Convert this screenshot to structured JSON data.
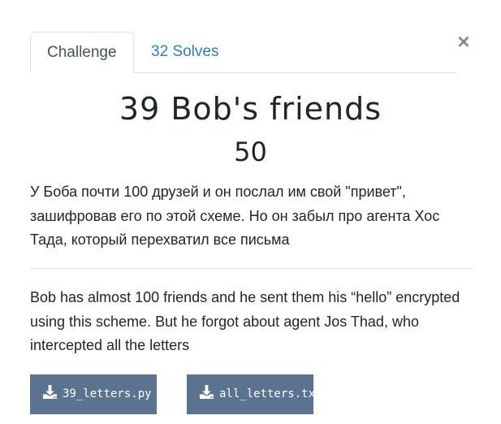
{
  "modal": {
    "close_symbol": "×",
    "tabs": [
      {
        "label": "Challenge",
        "active": true
      },
      {
        "label": "32 Solves",
        "active": false
      }
    ]
  },
  "challenge": {
    "title": "39 Bob's friends",
    "points": "50",
    "description_ru": "У Боба почти 100 друзей и он послал им свой \"привет\", зашифровав его по этой схеме. Но он забыл про агента Хос Тада, который перехватил все письма",
    "description_en": "Bob has almost 100 friends and he sent them his “hello” encrypted using this scheme. But he forgot about agent Jos Thad, who intercepted all the letters"
  },
  "files": [
    {
      "name": "39_letters.py",
      "icon": "download-icon"
    },
    {
      "name": "all_letters.txt",
      "icon": "download-icon"
    }
  ],
  "colors": {
    "accent_link": "#337ab7",
    "file_button_bg": "#5b7290",
    "text": "#212529",
    "close_icon": "#8a8a8a"
  }
}
